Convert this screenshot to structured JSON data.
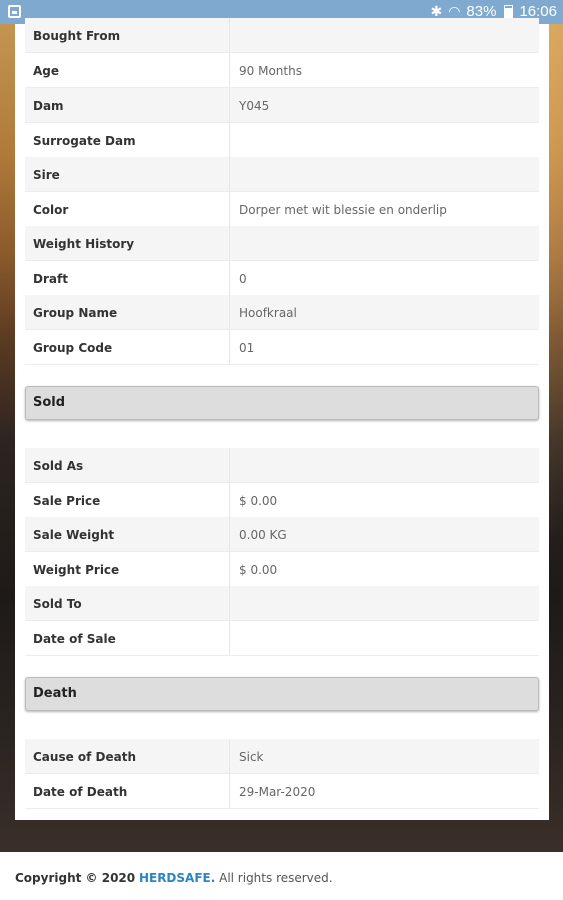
{
  "status_bar": {
    "battery": "83%",
    "time": "16:06",
    "icons": [
      "image-icon",
      "bluetooth-icon",
      "wifi-icon",
      "battery-icon"
    ]
  },
  "details": {
    "rows": [
      {
        "label": "Bought From",
        "value": ""
      },
      {
        "label": "Age",
        "value": "90 Months"
      },
      {
        "label": "Dam",
        "value": "Y045"
      },
      {
        "label": "Surrogate Dam",
        "value": ""
      },
      {
        "label": "Sire",
        "value": ""
      },
      {
        "label": "Color",
        "value": "Dorper met wit blessie en onderlip"
      },
      {
        "label": "Weight History",
        "value": ""
      },
      {
        "label": "Draft",
        "value": "0"
      },
      {
        "label": "Group Name",
        "value": "Hoofkraal"
      },
      {
        "label": "Group Code",
        "value": "01"
      }
    ]
  },
  "sold": {
    "title": "Sold",
    "rows": [
      {
        "label": "Sold As",
        "value": ""
      },
      {
        "label": "Sale Price",
        "value": "$ 0.00"
      },
      {
        "label": "Sale Weight",
        "value": "0.00 KG"
      },
      {
        "label": "Weight Price",
        "value": "$ 0.00"
      },
      {
        "label": "Sold To",
        "value": ""
      },
      {
        "label": "Date of Sale",
        "value": ""
      }
    ]
  },
  "death": {
    "title": "Death",
    "rows": [
      {
        "label": "Cause of Death",
        "value": "Sick"
      },
      {
        "label": "Date of Death",
        "value": "29-Mar-2020"
      }
    ]
  },
  "footer": {
    "copyright": "Copyright © 2020",
    "brand": "HERDSAFE.",
    "rights": "All rights reserved."
  }
}
